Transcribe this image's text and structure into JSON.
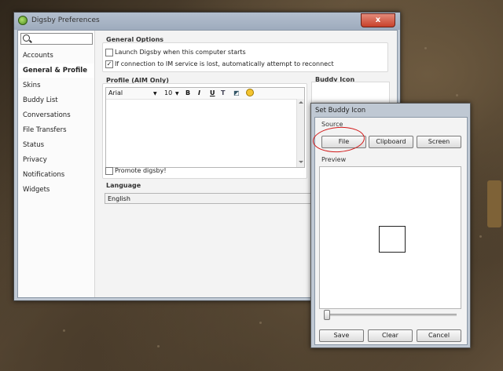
{
  "window": {
    "title": "Digsby Preferences",
    "close_glyph": "x"
  },
  "sidebar": {
    "search_placeholder": "",
    "items": [
      {
        "label": "Accounts"
      },
      {
        "label": "General & Profile"
      },
      {
        "label": "Skins"
      },
      {
        "label": "Buddy List"
      },
      {
        "label": "Conversations"
      },
      {
        "label": "File Transfers"
      },
      {
        "label": "Status"
      },
      {
        "label": "Privacy"
      },
      {
        "label": "Notifications"
      },
      {
        "label": "Widgets"
      }
    ],
    "active_item": "General & Profile"
  },
  "general_options": {
    "heading": "General Options",
    "launch_label": "Launch Digsby when this computer starts",
    "launch_checked": false,
    "reconnect_label": "If connection to IM service is lost, automatically attempt to reconnect",
    "reconnect_checked": true
  },
  "profile": {
    "heading": "Profile (AIM Only)",
    "font_name": "Arial",
    "font_size": "10",
    "bold": "B",
    "italic": "I",
    "underline": "U",
    "promote_label": "Promote digsby!",
    "promote_checked": false
  },
  "buddy_icon": {
    "heading": "Buddy Icon"
  },
  "language": {
    "heading": "Language",
    "selected": "English"
  },
  "dialog": {
    "title": "Set Buddy Icon",
    "source_label": "Source",
    "file_button": "File",
    "clipboard_button": "Clipboard",
    "screen_button": "Screen",
    "preview_label": "Preview",
    "save_button": "Save",
    "clear_button": "Clear",
    "cancel_button": "Cancel",
    "zoom_level": 0
  },
  "colors": {
    "annotation": "#d21b1b",
    "window_frame": "#bfc8d3"
  }
}
